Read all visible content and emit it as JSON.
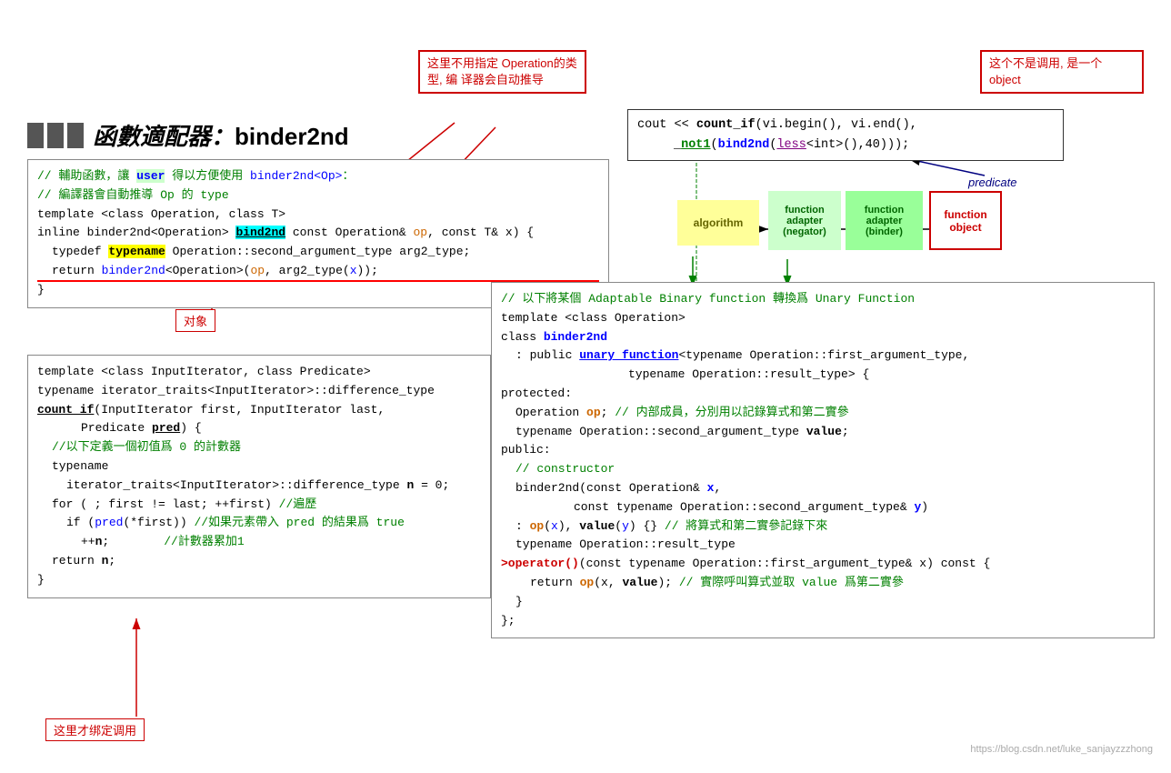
{
  "page": {
    "title": "函數適配器：binder2nd",
    "watermark": "https://blog.csdn.net/luke_sanjayzzzhong"
  },
  "annotations": {
    "top_left": "这里不用指定\nOperation的类型, 编\n译器会自动推导",
    "top_right": "这个不是调用, 是一个\nobject",
    "middle_left": "对象",
    "bottom_left": "这里才绑定调用"
  },
  "diagram": {
    "algorithm": "algorithm",
    "function_adapter_negator": "function\nadapter\n(negator)",
    "function_adapter_binder": "function\nadapter\n(binder)",
    "function_object": "function\nobject"
  },
  "code": {
    "call_line1": "cout << count_if(vi.begin(), vi.end(),",
    "call_line2": "         _not1(bind2nd(less<int>(),40)));",
    "predicate": "predicate"
  }
}
